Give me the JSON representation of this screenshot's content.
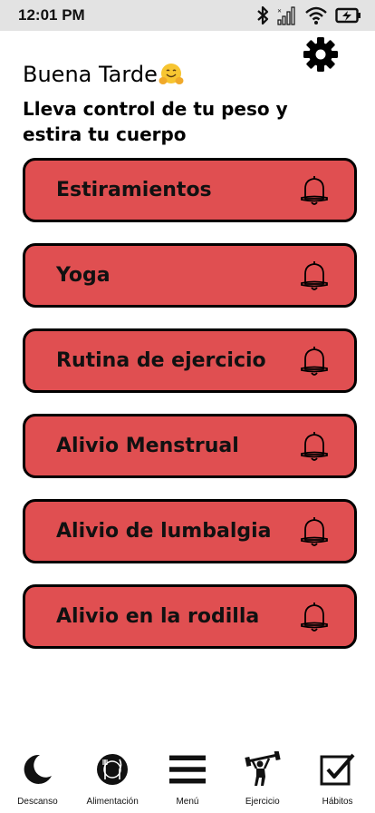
{
  "status": {
    "time": "12:01 PM",
    "icons": [
      "bluetooth-icon",
      "signal-icon",
      "wifi-icon",
      "battery-charging-icon"
    ]
  },
  "header": {
    "greeting": "Buena Tarde",
    "greeting_emoji": "hugging-face-emoji",
    "subtitle": "Lleva control de tu peso y estira tu cuerpo",
    "settings_icon": "gear-icon"
  },
  "routines": [
    {
      "label": "Estiramientos",
      "icon": "bell-icon"
    },
    {
      "label": "Yoga",
      "icon": "bell-icon"
    },
    {
      "label": "Rutina de ejercicio",
      "icon": "bell-icon"
    },
    {
      "label": "Alivio Menstrual",
      "icon": "bell-icon"
    },
    {
      "label": "Alivio de lumbalgia",
      "icon": "bell-icon"
    },
    {
      "label": "Alivio en la rodilla",
      "icon": "bell-icon"
    }
  ],
  "nav": [
    {
      "label": "Descanso",
      "icon": "moon-icon"
    },
    {
      "label": "Alimentación",
      "icon": "food-icon"
    },
    {
      "label": "Menú",
      "icon": "menu-icon"
    },
    {
      "label": "Ejercicio",
      "icon": "weightlifting-icon"
    },
    {
      "label": "Hábitos",
      "icon": "checkbox-icon"
    }
  ],
  "colors": {
    "card_background": "#e04f51",
    "card_border": "#000000",
    "status_bar": "#e3e3e3",
    "background": "#ffffff"
  }
}
